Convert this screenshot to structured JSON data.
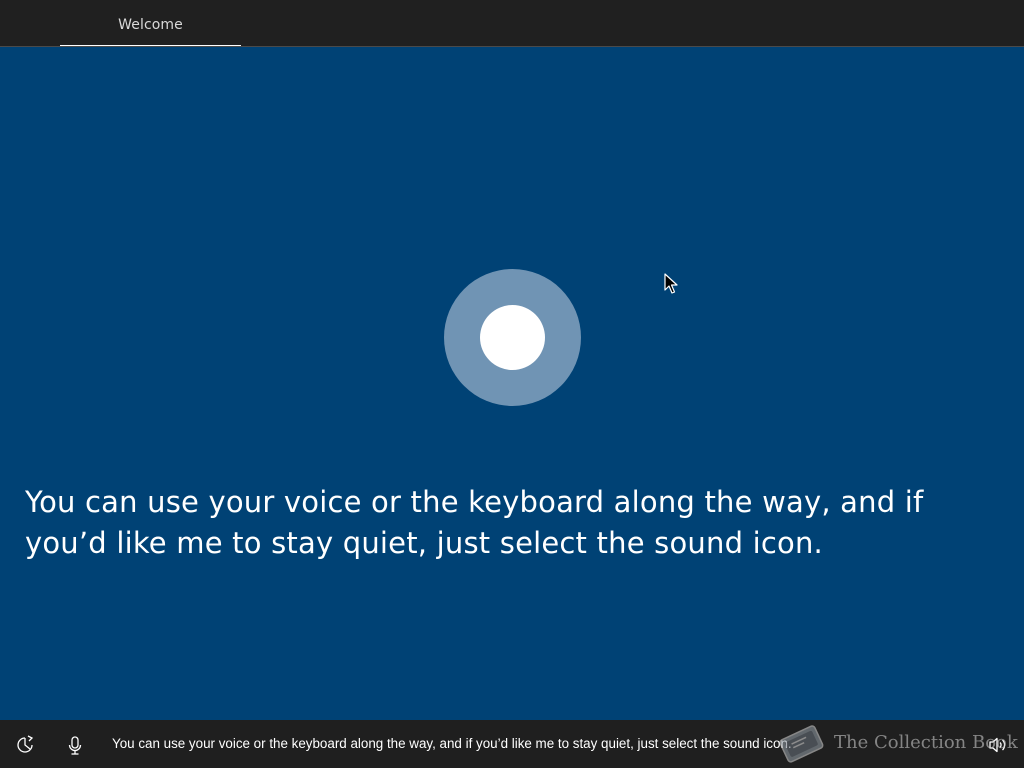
{
  "header": {
    "tabs": [
      {
        "label": "Welcome",
        "active": true
      }
    ]
  },
  "main": {
    "message": "You can use your voice or the keyboard along the way, and if you’d like me to stay quiet, just select the sound icon.",
    "assistant_icon": "cortana-circle-icon"
  },
  "footer": {
    "caption": "You can use your voice or the keyboard along the way, and if you’d like me to stay quiet, just select the sound icon.",
    "icons": {
      "ease_of_access": "ease-of-access-icon",
      "microphone": "microphone-icon",
      "sound": "speaker-icon"
    }
  },
  "watermark": {
    "text": "The Collection Book"
  },
  "colors": {
    "background": "#004275",
    "topbar": "#202020",
    "bottombar": "#1f1f1f",
    "cortana_ring": "#7094b4",
    "text": "#ffffff"
  }
}
